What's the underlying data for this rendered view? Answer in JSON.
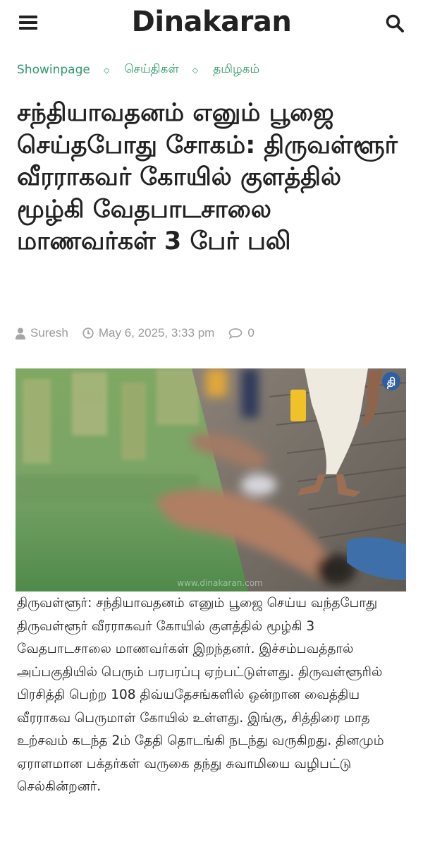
{
  "header": {
    "logo": "Dinakaran",
    "menu_icon": "hamburger-menu-icon",
    "search_icon": "search-icon"
  },
  "breadcrumb": {
    "items": [
      "Showinpage",
      "செய்திகள்",
      "தமிழகம்"
    ],
    "separator_icon": "diamond-icon",
    "color": "#2f9a6c"
  },
  "article": {
    "title": "சந்தியாவதனம் எனும் பூஜை செய்தபோது சோகம்: திருவள்ளூர் வீரராகவர் கோயில் குளத்தில் மூழ்கி வேதபாடசாலை மாணவர்கள் 3 பேர் பலி",
    "author": "Suresh",
    "date": "May 6, 2025, 3:33 pm",
    "comments": "0",
    "image_watermark": "www.dinakaran.com",
    "image_logo": "தி",
    "body": "திருவள்ளூர்: சந்தியாவதனம் எனும் பூஜை செய்ய வந்தபோது திருவள்ளூர் வீரராகவர் கோயில் குளத்தில் மூழ்கி 3 வேதபாடசாலை மாணவர்கள் இறந்தனர். இச்சம்பவத்தால் அப்பகுதியில் பெரும் பரபரப்பு ஏற்பட்டுள்ளது. திருவள்ளூரில் பிரசித்தி பெற்ற 108 திவ்யதேசங்களில் ஒன்றான வைத்திய வீரராகவ பெருமாள் கோயில் உள்ளது. இங்கு, சித்திரை மாத உற்சவம் கடந்த 2ம் தேதி தொடங்கி நடந்து வருகிறது. தினமும் ஏராளமான பக்தர்கள் வருகை தந்து சுவாமியை வழிபட்டு செல்கின்றனர்."
  },
  "icons": {
    "author": "user-icon",
    "date": "clock-icon",
    "comments": "comment-icon"
  }
}
